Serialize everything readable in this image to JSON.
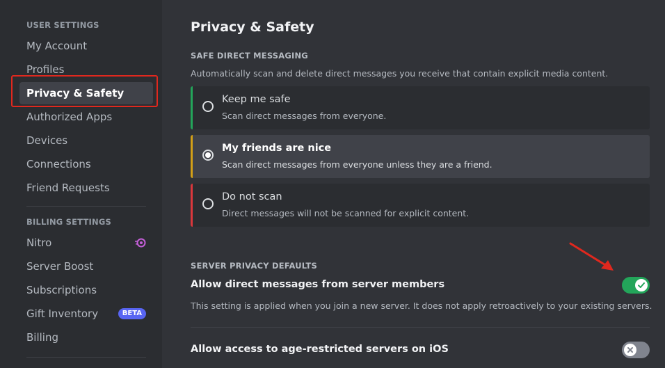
{
  "sidebar": {
    "user_settings_header": "User Settings",
    "user_items": [
      "My Account",
      "Profiles",
      "Privacy & Safety",
      "Authorized Apps",
      "Devices",
      "Connections",
      "Friend Requests"
    ],
    "billing_header": "Billing Settings",
    "billing_items": [
      "Nitro",
      "Server Boost",
      "Subscriptions",
      "Gift Inventory",
      "Billing"
    ],
    "beta_badge": "BETA",
    "active_item": "Privacy & Safety",
    "nitro_icon": "nitro-icon"
  },
  "main": {
    "title": "Privacy & Safety",
    "safe_dm": {
      "header": "Safe Direct Messaging",
      "description": "Automatically scan and delete direct messages you receive that contain explicit media content.",
      "options": [
        {
          "title": "Keep me safe",
          "description": "Scan direct messages from everyone.",
          "accent": "#23a55a",
          "selected": false
        },
        {
          "title": "My friends are nice",
          "description": "Scan direct messages from everyone unless they are a friend.",
          "accent": "#d4a017",
          "selected": true
        },
        {
          "title": "Do not scan",
          "description": "Direct messages will not be scanned for explicit content.",
          "accent": "#da373c",
          "selected": false
        }
      ]
    },
    "server_privacy": {
      "header": "Server Privacy Defaults",
      "settings": [
        {
          "title": "Allow direct messages from server members",
          "description": "This setting is applied when you join a new server. It does not apply retroactively to your existing servers.",
          "enabled": true
        },
        {
          "title": "Allow access to age-restricted servers on iOS",
          "enabled": false
        }
      ]
    }
  },
  "colors": {
    "accent_green": "#23a55a",
    "annotation_red": "#e0281e",
    "brand": "#5865f2"
  }
}
